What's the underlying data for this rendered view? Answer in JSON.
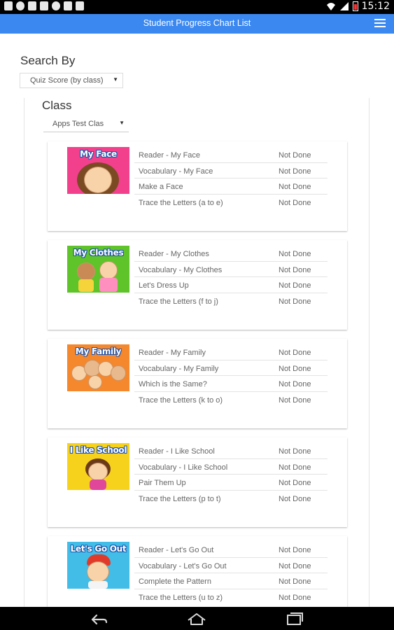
{
  "status_bar": {
    "time": "15:12",
    "icons": [
      "usb-icon",
      "shield-icon",
      "document-icon",
      "image-icon",
      "target-icon",
      "bag-icon",
      "image-icon",
      "wifi-icon",
      "signal-icon",
      "battery-icon"
    ]
  },
  "app_bar": {
    "title": "Student Progress Chart List",
    "menu_icon": "hamburger-menu-icon"
  },
  "search": {
    "label": "Search By",
    "selected": "Quiz Score (by class)"
  },
  "class_filter": {
    "label": "Class",
    "selected": "Apps Test Clas"
  },
  "units": [
    {
      "title": "My Face",
      "colors": {
        "bg": "#f2408c",
        "accent": "#ffd6ea"
      },
      "rows": [
        {
          "name": "Reader - My Face",
          "status": "Not Done"
        },
        {
          "name": "Vocabulary - My Face",
          "status": "Not Done"
        },
        {
          "name": "Make a Face",
          "status": "Not Done"
        },
        {
          "name": "Trace the Letters (a to e)",
          "status": "Not Done"
        }
      ]
    },
    {
      "title": "My Clothes",
      "colors": {
        "bg": "#5ec42a",
        "accent": "#a8ea5a"
      },
      "rows": [
        {
          "name": "Reader - My Clothes",
          "status": "Not Done"
        },
        {
          "name": "Vocabulary - My Clothes",
          "status": "Not Done"
        },
        {
          "name": "Let's Dress Up",
          "status": "Not Done"
        },
        {
          "name": "Trace the Letters (f to j)",
          "status": "Not Done"
        }
      ]
    },
    {
      "title": "My Family",
      "colors": {
        "bg": "#f5872c",
        "accent": "#ffc48a"
      },
      "rows": [
        {
          "name": "Reader - My Family",
          "status": "Not Done"
        },
        {
          "name": "Vocabulary - My Family",
          "status": "Not Done"
        },
        {
          "name": "Which is the Same?",
          "status": "Not Done"
        },
        {
          "name": "Trace the Letters (k to o)",
          "status": "Not Done"
        }
      ]
    },
    {
      "title": "I Like School",
      "colors": {
        "bg": "#f7d21c",
        "accent": "#fff080"
      },
      "rows": [
        {
          "name": "Reader - I Like School",
          "status": "Not Done"
        },
        {
          "name": "Vocabulary - I Like School",
          "status": "Not Done"
        },
        {
          "name": "Pair Them Up",
          "status": "Not Done"
        },
        {
          "name": "Trace the Letters (p to t)",
          "status": "Not Done"
        }
      ]
    },
    {
      "title": "Let's Go Out",
      "colors": {
        "bg": "#41bde8",
        "accent": "#a8e6fa"
      },
      "rows": [
        {
          "name": "Reader - Let's Go Out",
          "status": "Not Done"
        },
        {
          "name": "Vocabulary - Let's Go Out",
          "status": "Not Done"
        },
        {
          "name": "Complete the Pattern",
          "status": "Not Done"
        },
        {
          "name": "Trace the Letters (u to z)",
          "status": "Not Done"
        }
      ]
    }
  ],
  "nav_bar": {
    "icons": [
      "back-icon",
      "home-icon",
      "recent-apps-icon"
    ]
  }
}
